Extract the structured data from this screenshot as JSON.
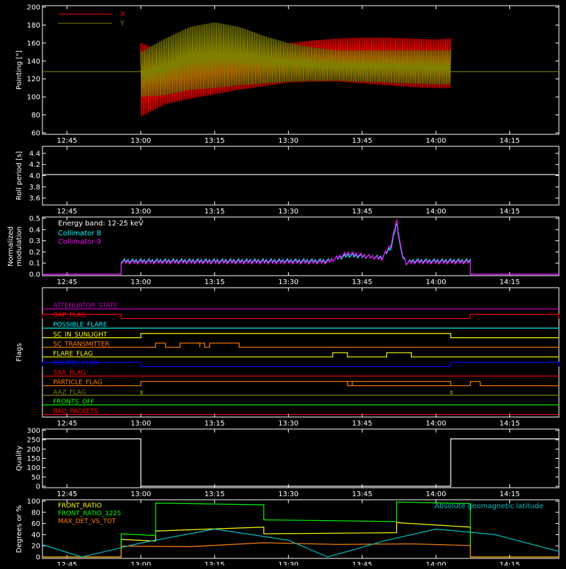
{
  "chart_data": [
    {
      "type": "line",
      "panel": "pointing",
      "ylabel": "Pointing [\"]",
      "ylim": [
        60,
        200
      ],
      "yticks": [
        60,
        80,
        100,
        120,
        140,
        160,
        180,
        200
      ],
      "x_ticklabels": [
        "12:45",
        "13:00",
        "13:15",
        "13:30",
        "13:45",
        "14:00",
        "14:15"
      ],
      "series": [
        {
          "name": "X",
          "color": "#ff0000",
          "x": [
            "13:00",
            "13:05",
            "13:10",
            "13:15",
            "13:20",
            "13:25",
            "13:30",
            "13:35",
            "13:40",
            "13:45",
            "13:50",
            "13:55",
            "14:00",
            "14:03"
          ],
          "y_min": [
            78,
            92,
            98,
            103,
            108,
            112,
            116,
            117,
            117,
            115,
            113,
            111,
            110,
            110
          ],
          "y_max": [
            160,
            150,
            150,
            152,
            155,
            158,
            160,
            163,
            165,
            166,
            166,
            165,
            164,
            165
          ]
        },
        {
          "name": "Y",
          "color": "#808000",
          "x": [
            "13:00",
            "13:05",
            "13:10",
            "13:15",
            "13:20",
            "13:25",
            "13:30",
            "13:35",
            "13:40",
            "13:45",
            "13:50",
            "13:55",
            "14:00",
            "14:03"
          ],
          "y_min": [
            100,
            102,
            108,
            110,
            113,
            115,
            117,
            118,
            118,
            117,
            116,
            115,
            114,
            114
          ],
          "y_max": [
            150,
            165,
            178,
            183,
            178,
            168,
            160,
            155,
            152,
            152,
            152,
            152,
            152,
            152
          ],
          "baseline": 128
        }
      ]
    },
    {
      "type": "line",
      "panel": "roll-period",
      "ylabel": "Roll period [s]",
      "ylim": [
        3.5,
        4.5
      ],
      "yticks": [
        "3.6",
        "3.8",
        "4.0",
        "4.2",
        "4.4"
      ],
      "x_ticklabels": [
        "12:45",
        "13:00",
        "13:15",
        "13:30",
        "13:45",
        "14:00",
        "14:15"
      ],
      "series": [
        {
          "name": "",
          "color": "#ffffff",
          "x": [
            "12:40",
            "14:25"
          ],
          "y": [
            4.02,
            4.02
          ]
        }
      ]
    },
    {
      "type": "line",
      "panel": "modulation",
      "ylabel": "Normalized modulation",
      "ylim": [
        0,
        0.5
      ],
      "yticks": [
        "0.0",
        "0.1",
        "0.2",
        "0.3",
        "0.4",
        "0.5"
      ],
      "x_ticklabels": [
        "12:45",
        "13:00",
        "13:15",
        "13:30",
        "13:45",
        "14:00",
        "14:15"
      ],
      "annotation": "Energy band: 12-25 keV",
      "series": [
        {
          "name": "Collimator 8",
          "color": "#00ffff",
          "x": [
            "12:56",
            "13:20",
            "13:38",
            "13:42",
            "13:49",
            "13:51",
            "13:52",
            "13:53",
            "13:54",
            "13:55",
            "14:07"
          ],
          "y": [
            0.12,
            0.12,
            0.12,
            0.17,
            0.15,
            0.25,
            0.47,
            0.18,
            0.1,
            0.12,
            0.12
          ]
        },
        {
          "name": "Collimator 9",
          "color": "#ff00ff",
          "x": [
            "12:56",
            "13:20",
            "13:38",
            "13:42",
            "13:49",
            "13:51",
            "13:52",
            "13:53",
            "13:54",
            "13:55",
            "14:07"
          ],
          "y": [
            0.11,
            0.11,
            0.11,
            0.19,
            0.14,
            0.28,
            0.5,
            0.2,
            0.1,
            0.11,
            0.11
          ]
        }
      ]
    },
    {
      "type": "line",
      "panel": "flags",
      "ylabel": "Flags",
      "x_ticklabels": [
        "12:45",
        "13:00",
        "13:15",
        "13:30",
        "13:45",
        "14:00",
        "14:15"
      ],
      "series": [
        {
          "name": "ATTENUATOR_STATE",
          "color": "#c000c0",
          "on": []
        },
        {
          "name": "GAP_FLAG",
          "color": "#ff0000",
          "on": [
            [
              "12:40",
              "12:56"
            ],
            [
              "14:07",
              "14:25"
            ]
          ]
        },
        {
          "name": "POSSIBLE_FLARE",
          "color": "#00ffff",
          "on": []
        },
        {
          "name": "SC_IN_SUNLIGHT",
          "color": "#ffff00",
          "on": [
            [
              "13:00",
              "14:03"
            ]
          ]
        },
        {
          "name": "SC_TRANSMITTER",
          "color": "#ff8000",
          "on": [
            [
              "13:03",
              "13:05"
            ],
            [
              "13:08",
              "13:12"
            ],
            [
              "13:12",
              "13:13"
            ],
            [
              "13:14",
              "13:20"
            ]
          ]
        },
        {
          "name": "FLARE_FLAG",
          "color": "#ffff00",
          "on": [
            [
              "13:39",
              "13:42"
            ],
            [
              "13:50",
              "13:55"
            ]
          ]
        },
        {
          "name": "ECLIPSE_FLAG",
          "color": "#0000ff",
          "on": [
            [
              "12:40",
              "13:00"
            ],
            [
              "14:03",
              "14:25"
            ]
          ]
        },
        {
          "name": "SAA_FLAG",
          "color": "#ff0000",
          "on": []
        },
        {
          "name": "PARTICLE_FLAG",
          "color": "#ff8000",
          "on": [
            [
              "13:00",
              "14:03"
            ],
            [
              "13:42",
              "13:43"
            ],
            [
              "14:07",
              "14:09"
            ]
          ]
        },
        {
          "name": "AAZ_FLAG",
          "color": "#808000",
          "on": [
            [
              "13:00",
              "13:00"
            ],
            [
              "14:03",
              "14:03"
            ]
          ]
        },
        {
          "name": "FRONTS_OFF",
          "color": "#00ff00",
          "on": []
        },
        {
          "name": "BAD_PACKETS",
          "color": "#ff0000",
          "on": []
        }
      ]
    },
    {
      "type": "line",
      "panel": "quality",
      "ylabel": "Quality",
      "ylim": [
        0,
        300
      ],
      "yticks": [
        "0",
        "50",
        "100",
        "150",
        "200",
        "250",
        "300"
      ],
      "x_ticklabels": [
        "12:45",
        "13:00",
        "13:15",
        "13:30",
        "13:45",
        "14:00",
        "14:15"
      ],
      "series": [
        {
          "name": "",
          "color": "#ffffff",
          "x": [
            "12:40",
            "13:00",
            "13:00",
            "14:03",
            "14:03",
            "14:25"
          ],
          "y": [
            255,
            255,
            0,
            0,
            255,
            255
          ]
        }
      ]
    },
    {
      "type": "line",
      "panel": "degrees",
      "ylabel": "Degrees or %",
      "ylim": [
        0,
        100
      ],
      "yticks": [
        "0",
        "20",
        "40",
        "60",
        "80",
        "100"
      ],
      "x_ticklabels": [
        "12:45",
        "13:00",
        "13:15",
        "13:30",
        "13:45",
        "14:00",
        "14:15"
      ],
      "series": [
        {
          "name": "FRONT_RATIO",
          "color": "#ffff00",
          "x": [
            "12:56",
            "13:03",
            "13:03",
            "13:25",
            "13:25",
            "13:52",
            "13:52",
            "14:07"
          ],
          "y": [
            30,
            30,
            45,
            55,
            40,
            45,
            60,
            55
          ]
        },
        {
          "name": "FRONT_RATIO_1225",
          "color": "#00ff00",
          "x": [
            "12:56",
            "13:03",
            "13:03",
            "13:25",
            "13:25",
            "13:52",
            "13:52",
            "14:07"
          ],
          "y": [
            40,
            40,
            95,
            95,
            65,
            65,
            97,
            97
          ]
        },
        {
          "name": "MAX_DET_VS_TOT",
          "color": "#ff8000",
          "x": [
            "12:56",
            "13:10",
            "13:25",
            "13:40",
            "13:55",
            "14:07"
          ],
          "y": [
            18,
            20,
            24,
            24,
            22,
            22
          ]
        },
        {
          "name": "Absolute geomagnetic latitude",
          "color": "#00c0c0",
          "x": [
            "12:40",
            "12:48",
            "13:00",
            "13:15",
            "13:30",
            "13:38",
            "13:50",
            "14:00",
            "14:12",
            "14:25"
          ],
          "y": [
            22,
            0,
            25,
            50,
            30,
            0,
            30,
            50,
            40,
            10
          ]
        }
      ]
    }
  ]
}
